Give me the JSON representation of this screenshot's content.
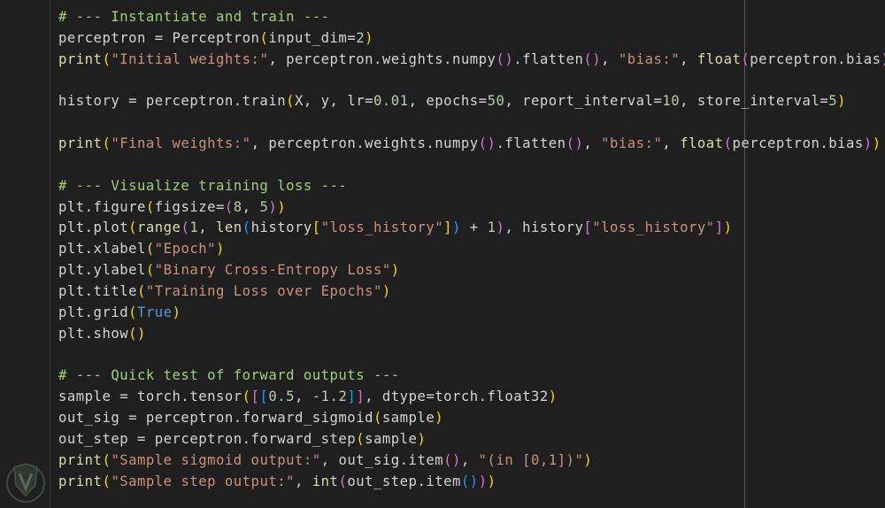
{
  "lines": [
    [
      {
        "t": "# --- Instantiate and train ---",
        "c": "comment"
      }
    ],
    [
      {
        "t": "perceptron = Perceptron"
      },
      {
        "t": "(",
        "c": "b1"
      },
      {
        "t": "input_dim="
      },
      {
        "t": "2",
        "c": "number"
      },
      {
        "t": ")",
        "c": "b1"
      }
    ],
    [
      {
        "t": "print",
        "c": "builtin"
      },
      {
        "t": "(",
        "c": "b1"
      },
      {
        "t": "\"Initial weights:\"",
        "c": "string"
      },
      {
        "t": ", perceptron.weights.numpy"
      },
      {
        "t": "()",
        "c": "b2"
      },
      {
        "t": ".flatten"
      },
      {
        "t": "()",
        "c": "b2"
      },
      {
        "t": ", "
      },
      {
        "t": "\"bias:\"",
        "c": "string"
      },
      {
        "t": ", "
      },
      {
        "t": "float",
        "c": "builtin"
      },
      {
        "t": "(",
        "c": "b2"
      },
      {
        "t": "perceptron.bias"
      },
      {
        "t": ")",
        "c": "b2"
      },
      {
        "t": ")",
        "c": "b1"
      }
    ],
    [],
    [
      {
        "t": "history = perceptron.train"
      },
      {
        "t": "(",
        "c": "b1"
      },
      {
        "t": "X, y, lr="
      },
      {
        "t": "0.01",
        "c": "number"
      },
      {
        "t": ", epochs="
      },
      {
        "t": "50",
        "c": "number"
      },
      {
        "t": ", report_interval="
      },
      {
        "t": "10",
        "c": "number"
      },
      {
        "t": ", store_interval="
      },
      {
        "t": "5",
        "c": "number"
      },
      {
        "t": ")",
        "c": "b1"
      }
    ],
    [],
    [
      {
        "t": "print",
        "c": "builtin"
      },
      {
        "t": "(",
        "c": "b1"
      },
      {
        "t": "\"Final weights:\"",
        "c": "string"
      },
      {
        "t": ", perceptron.weights.numpy"
      },
      {
        "t": "()",
        "c": "b2"
      },
      {
        "t": ".flatten"
      },
      {
        "t": "()",
        "c": "b2"
      },
      {
        "t": ", "
      },
      {
        "t": "\"bias:\"",
        "c": "string"
      },
      {
        "t": ", "
      },
      {
        "t": "float",
        "c": "builtin"
      },
      {
        "t": "(",
        "c": "b2"
      },
      {
        "t": "perceptron.bias"
      },
      {
        "t": ")",
        "c": "b2"
      },
      {
        "t": ")",
        "c": "b1"
      }
    ],
    [],
    [
      {
        "t": "# --- Visualize training loss ---",
        "c": "comment"
      }
    ],
    [
      {
        "t": "plt.figure"
      },
      {
        "t": "(",
        "c": "b1"
      },
      {
        "t": "figsize="
      },
      {
        "t": "(",
        "c": "b2"
      },
      {
        "t": "8",
        "c": "number"
      },
      {
        "t": ", "
      },
      {
        "t": "5",
        "c": "number"
      },
      {
        "t": ")",
        "c": "b2"
      },
      {
        "t": ")",
        "c": "b1"
      }
    ],
    [
      {
        "t": "plt.plot"
      },
      {
        "t": "(",
        "c": "b1"
      },
      {
        "t": "range",
        "c": "builtin"
      },
      {
        "t": "(",
        "c": "b2"
      },
      {
        "t": "1",
        "c": "number"
      },
      {
        "t": ", "
      },
      {
        "t": "len",
        "c": "builtin"
      },
      {
        "t": "(",
        "c": "b3"
      },
      {
        "t": "history"
      },
      {
        "t": "[",
        "c": "b1"
      },
      {
        "t": "\"loss_history\"",
        "c": "string"
      },
      {
        "t": "]",
        "c": "b1"
      },
      {
        "t": ")",
        "c": "b3"
      },
      {
        "t": " + "
      },
      {
        "t": "1",
        "c": "number"
      },
      {
        "t": ")",
        "c": "b2"
      },
      {
        "t": ", history"
      },
      {
        "t": "[",
        "c": "b2"
      },
      {
        "t": "\"loss_history\"",
        "c": "string"
      },
      {
        "t": "]",
        "c": "b2"
      },
      {
        "t": ")",
        "c": "b1"
      }
    ],
    [
      {
        "t": "plt.xlabel"
      },
      {
        "t": "(",
        "c": "b1"
      },
      {
        "t": "\"Epoch\"",
        "c": "string"
      },
      {
        "t": ")",
        "c": "b1"
      }
    ],
    [
      {
        "t": "plt.ylabel"
      },
      {
        "t": "(",
        "c": "b1"
      },
      {
        "t": "\"Binary Cross-Entropy Loss\"",
        "c": "string"
      },
      {
        "t": ")",
        "c": "b1"
      }
    ],
    [
      {
        "t": "plt.title"
      },
      {
        "t": "(",
        "c": "b1"
      },
      {
        "t": "\"Training Loss over Epochs\"",
        "c": "string"
      },
      {
        "t": ")",
        "c": "b1"
      }
    ],
    [
      {
        "t": "plt.grid"
      },
      {
        "t": "(",
        "c": "b1"
      },
      {
        "t": "True",
        "c": "kw"
      },
      {
        "t": ")",
        "c": "b1"
      }
    ],
    [
      {
        "t": "plt.show"
      },
      {
        "t": "()",
        "c": "b1"
      }
    ],
    [],
    [
      {
        "t": "# --- Quick test of forward outputs ---",
        "c": "comment"
      }
    ],
    [
      {
        "t": "sample = torch.tensor"
      },
      {
        "t": "(",
        "c": "b1"
      },
      {
        "t": "[",
        "c": "b2"
      },
      {
        "t": "[",
        "c": "b3"
      },
      {
        "t": "0.5",
        "c": "number"
      },
      {
        "t": ", "
      },
      {
        "t": "-1.2",
        "c": "number"
      },
      {
        "t": "]",
        "c": "b3"
      },
      {
        "t": "]",
        "c": "b2"
      },
      {
        "t": ", dtype=torch.float32"
      },
      {
        "t": ")",
        "c": "b1"
      }
    ],
    [
      {
        "t": "out_sig = perceptron.forward_sigmoid"
      },
      {
        "t": "(",
        "c": "b1"
      },
      {
        "t": "sample"
      },
      {
        "t": ")",
        "c": "b1"
      }
    ],
    [
      {
        "t": "out_step = perceptron.forward_step"
      },
      {
        "t": "(",
        "c": "b1"
      },
      {
        "t": "sample"
      },
      {
        "t": ")",
        "c": "b1"
      }
    ],
    [
      {
        "t": "print",
        "c": "builtin"
      },
      {
        "t": "(",
        "c": "b1"
      },
      {
        "t": "\"Sample sigmoid output:\"",
        "c": "string"
      },
      {
        "t": ", out_sig.item"
      },
      {
        "t": "()",
        "c": "b2"
      },
      {
        "t": ", "
      },
      {
        "t": "\"(in [0,1])\"",
        "c": "string"
      },
      {
        "t": ")",
        "c": "b1"
      }
    ],
    [
      {
        "t": "print",
        "c": "builtin"
      },
      {
        "t": "(",
        "c": "b1"
      },
      {
        "t": "\"Sample step output:\"",
        "c": "string"
      },
      {
        "t": ", "
      },
      {
        "t": "int",
        "c": "builtin"
      },
      {
        "t": "(",
        "c": "b2"
      },
      {
        "t": "out_step.item"
      },
      {
        "t": "()",
        "c": "b3"
      },
      {
        "t": ")",
        "c": "b2"
      },
      {
        "t": ")",
        "c": "b1"
      }
    ]
  ],
  "colors": {
    "background": "#1f1f1f",
    "default_text": "#d4d4d4",
    "comment": "#9ed17a",
    "string": "#ce9178",
    "number": "#b5cea8",
    "builtin": "#dcdcaa",
    "bracket_1": "#ffd700",
    "bracket_2": "#da70d6",
    "bracket_3": "#179fff",
    "keyword": "#569cd6"
  },
  "icons": {
    "watermark": "shield-v-logo-icon"
  }
}
